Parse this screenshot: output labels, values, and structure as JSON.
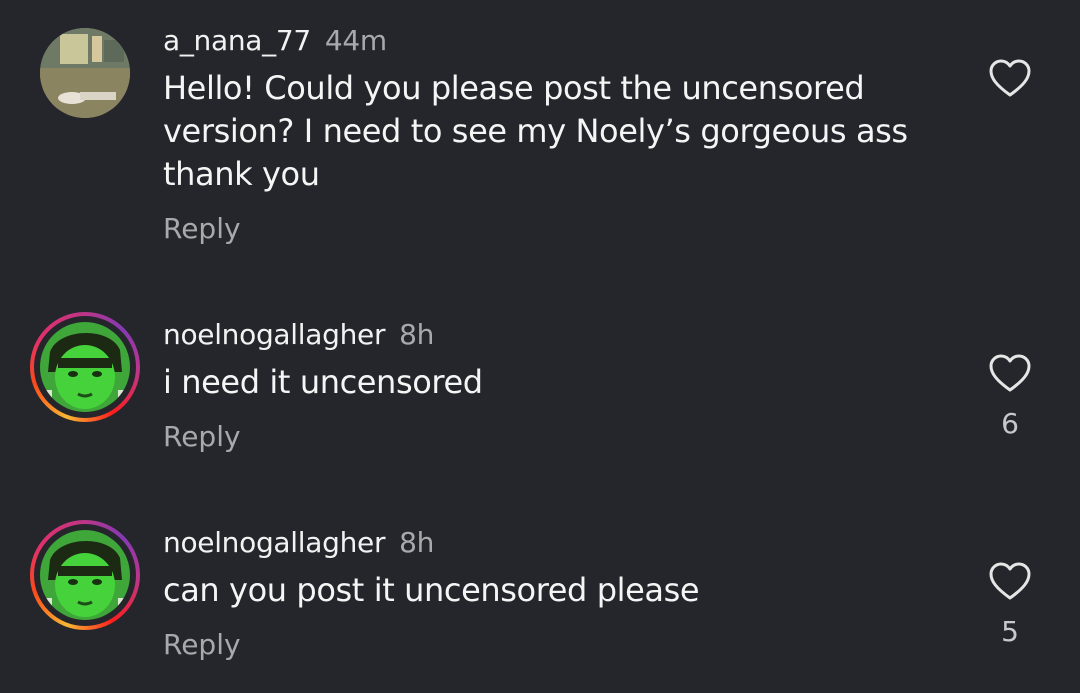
{
  "comments": [
    {
      "username": "a_nana_77",
      "time": "44m",
      "text": "Hello! Could you please post the uncensored\nversion? I need to see my Noely’s gorgeous ass\nthank you",
      "reply": "Reply",
      "likes": "",
      "has_story_ring": false
    },
    {
      "username": "noelnogallagher",
      "time": "8h",
      "text": "i need it uncensored",
      "reply": "Reply",
      "likes": "6",
      "has_story_ring": true
    },
    {
      "username": "noelnogallagher",
      "time": "8h",
      "text": "can you post it uncensored please",
      "reply": "Reply",
      "likes": "5",
      "has_story_ring": true
    }
  ],
  "icons": {
    "like": "heart-icon",
    "avatar": "avatar"
  },
  "colors": {
    "background": "#25262b",
    "text": "#f5f5f5",
    "secondary": "#a8a8ad"
  }
}
